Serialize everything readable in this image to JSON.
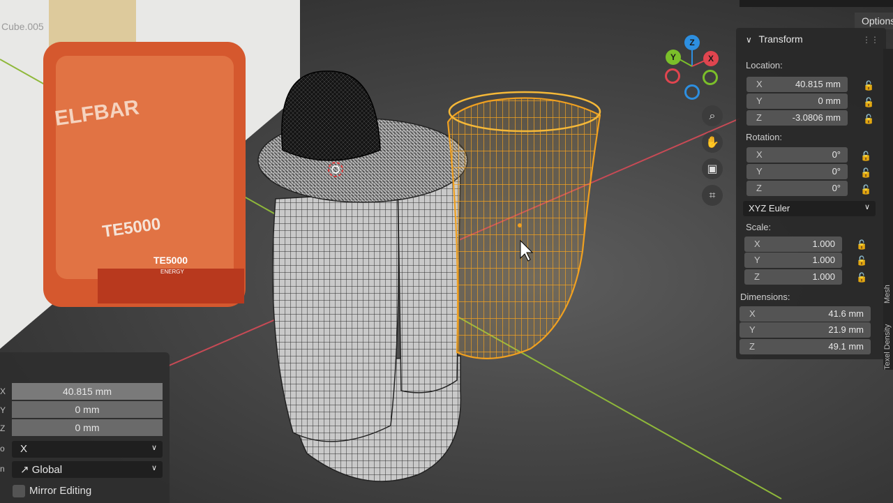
{
  "viewport": {
    "overlay_text": "Cube.005"
  },
  "header": {
    "options_label": "Options"
  },
  "gizmo": {
    "z_label": "Z",
    "y_label": "Y",
    "x_label": "X"
  },
  "icons": {
    "zoom": "zoom-icon",
    "pan": "hand-icon",
    "camera": "camera-icon",
    "ortho": "grid-icon"
  },
  "transform_panel": {
    "title": "Transform",
    "location": {
      "label": "Location:",
      "x": {
        "axis": "X",
        "value": "40.815 mm"
      },
      "y": {
        "axis": "Y",
        "value": "0 mm"
      },
      "z": {
        "axis": "Z",
        "value": "-3.0806 mm"
      }
    },
    "rotation": {
      "label": "Rotation:",
      "x": {
        "axis": "X",
        "value": "0°"
      },
      "y": {
        "axis": "Y",
        "value": "0°"
      },
      "z": {
        "axis": "Z",
        "value": "0°"
      },
      "mode": "XYZ Euler"
    },
    "scale": {
      "label": "Scale:",
      "x": {
        "axis": "X",
        "value": "1.000"
      },
      "y": {
        "axis": "Y",
        "value": "1.000"
      },
      "z": {
        "axis": "Z",
        "value": "1.000"
      }
    },
    "dimensions": {
      "label": "Dimensions:",
      "x": {
        "axis": "X",
        "value": "41.6 mm"
      },
      "y": {
        "axis": "Y",
        "value": "21.9 mm"
      },
      "z": {
        "axis": "Z",
        "value": "49.1 mm"
      }
    }
  },
  "side_tabs": {
    "mesh": "Mesh",
    "texel": "Texel Density"
  },
  "redo_panel": {
    "x_axis": "X",
    "y_axis": "Y",
    "z_axis": "Z",
    "x_value": "40.815 mm",
    "y_value": "0 mm",
    "z_value": "0 mm",
    "constraint_label": "o",
    "constraint_value": "X",
    "orientation_label": "n",
    "orientation_value": "Global",
    "mirror_label": "Mirror Editing"
  },
  "colors": {
    "selection": "#f0a020",
    "axis_x": "#e0454f",
    "axis_y": "#7bbf2a",
    "axis_z": "#2d8fe0"
  }
}
